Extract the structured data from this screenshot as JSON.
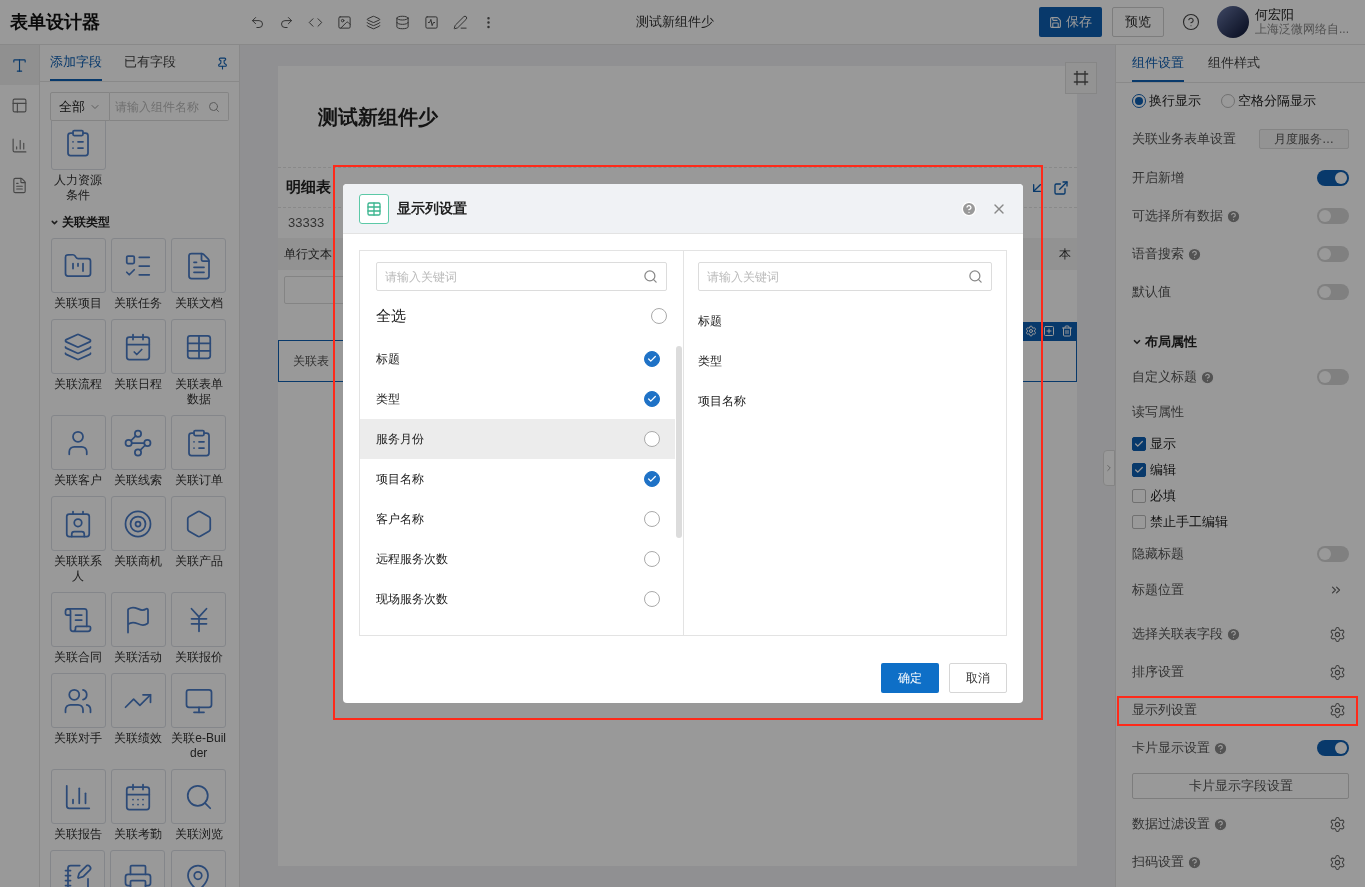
{
  "app": {
    "title": "表单设计器",
    "document_title": "测试新组件少",
    "save": "保存",
    "preview": "预览"
  },
  "user": {
    "name": "何宏阳",
    "org": "上海泛微网络自..."
  },
  "rail": [
    {
      "selected": true
    },
    {
      "selected": false
    },
    {
      "selected": false
    },
    {
      "selected": false
    }
  ],
  "left_panel": {
    "tabs": [
      {
        "label": "添加字段",
        "selected": true
      },
      {
        "label": "已有字段",
        "selected": false
      }
    ],
    "filter": "全部",
    "search": {
      "placeholder": "请输入组件名称"
    },
    "top_items": [
      "人力资源条件"
    ],
    "section": {
      "title": "关联类型",
      "expanded": true
    },
    "items": [
      "关联项目",
      "关联任务",
      "关联文档",
      "关联流程",
      "关联日程",
      "关联表单数据",
      "关联客户",
      "关联线索",
      "关联订单",
      "关联联系人",
      "关联商机",
      "关联产品",
      "关联合同",
      "关联活动",
      "关联报价",
      "关联对手",
      "关联绩效",
      "关联e-Builder",
      "关联报告",
      "关联考勤",
      "关联浏览"
    ]
  },
  "canvas": {
    "form_title": "测试新组件少",
    "detail_table": {
      "title": "明细表",
      "subtitle": "33333",
      "column_1": "单行文本",
      "column_2": "本"
    },
    "linked_field": "关联表"
  },
  "dialog": {
    "title": "显示列设置",
    "left_search": {
      "placeholder": "请输入关键词"
    },
    "select_all": {
      "label": "全选",
      "checked": false
    },
    "options": [
      {
        "label": "标题",
        "checked": true,
        "highlighted": false
      },
      {
        "label": "类型",
        "checked": true,
        "highlighted": false
      },
      {
        "label": "服务月份",
        "checked": false,
        "highlighted": true
      },
      {
        "label": "项目名称",
        "checked": true,
        "highlighted": false
      },
      {
        "label": "客户名称",
        "checked": false,
        "highlighted": false
      },
      {
        "label": "远程服务次数",
        "checked": false,
        "highlighted": false
      },
      {
        "label": "现场服务次数",
        "checked": false,
        "highlighted": false
      }
    ],
    "right_search": {
      "placeholder": "请输入关键词"
    },
    "selected_columns": [
      "标题",
      "类型",
      "项目名称"
    ],
    "confirm": "确定",
    "cancel": "取消"
  },
  "right_panel": {
    "tabs": [
      {
        "label": "组件设置",
        "selected": true
      },
      {
        "label": "组件样式",
        "selected": false
      }
    ],
    "display_mode": [
      {
        "label": "换行显示",
        "selected": true
      },
      {
        "label": "空格分隔显示",
        "selected": false
      }
    ],
    "rows": [
      {
        "kind": "select",
        "label": "关联业务表单设置",
        "value": "月度服务…"
      },
      {
        "kind": "toggle",
        "label": "开启新增",
        "help": false,
        "on": true
      },
      {
        "kind": "toggle",
        "label": "可选择所有数据",
        "help": true,
        "on": false
      },
      {
        "kind": "toggle",
        "label": "语音搜索",
        "help": true,
        "on": false
      },
      {
        "kind": "toggle",
        "label": "默认值",
        "help": false,
        "on": false
      },
      {
        "kind": "section",
        "label": "布局属性",
        "expanded": true
      },
      {
        "kind": "toggle",
        "label": "自定义标题",
        "help": true,
        "on": false
      },
      {
        "kind": "label",
        "label": "读写属性"
      },
      {
        "kind": "checkbox",
        "label": "显示",
        "checked": true
      },
      {
        "kind": "checkbox",
        "label": "编辑",
        "checked": true
      },
      {
        "kind": "checkbox",
        "label": "必填",
        "checked": false
      },
      {
        "kind": "checkbox",
        "label": "禁止手工编辑",
        "checked": false
      },
      {
        "kind": "toggle",
        "label": "隐藏标题",
        "help": false,
        "on": false
      },
      {
        "kind": "chevron",
        "label": "标题位置"
      },
      {
        "kind": "gear",
        "label": "选择关联表字段",
        "help": true
      },
      {
        "kind": "gear",
        "label": "排序设置",
        "help": false
      },
      {
        "kind": "gear",
        "label": "显示列设置",
        "help": false
      },
      {
        "kind": "toggle",
        "label": "卡片显示设置",
        "help": true,
        "on": true
      },
      {
        "kind": "wide-button",
        "label": "卡片显示字段设置"
      },
      {
        "kind": "gear",
        "label": "数据过滤设置",
        "help": true
      },
      {
        "kind": "gear",
        "label": "扫码设置",
        "help": true
      }
    ]
  }
}
